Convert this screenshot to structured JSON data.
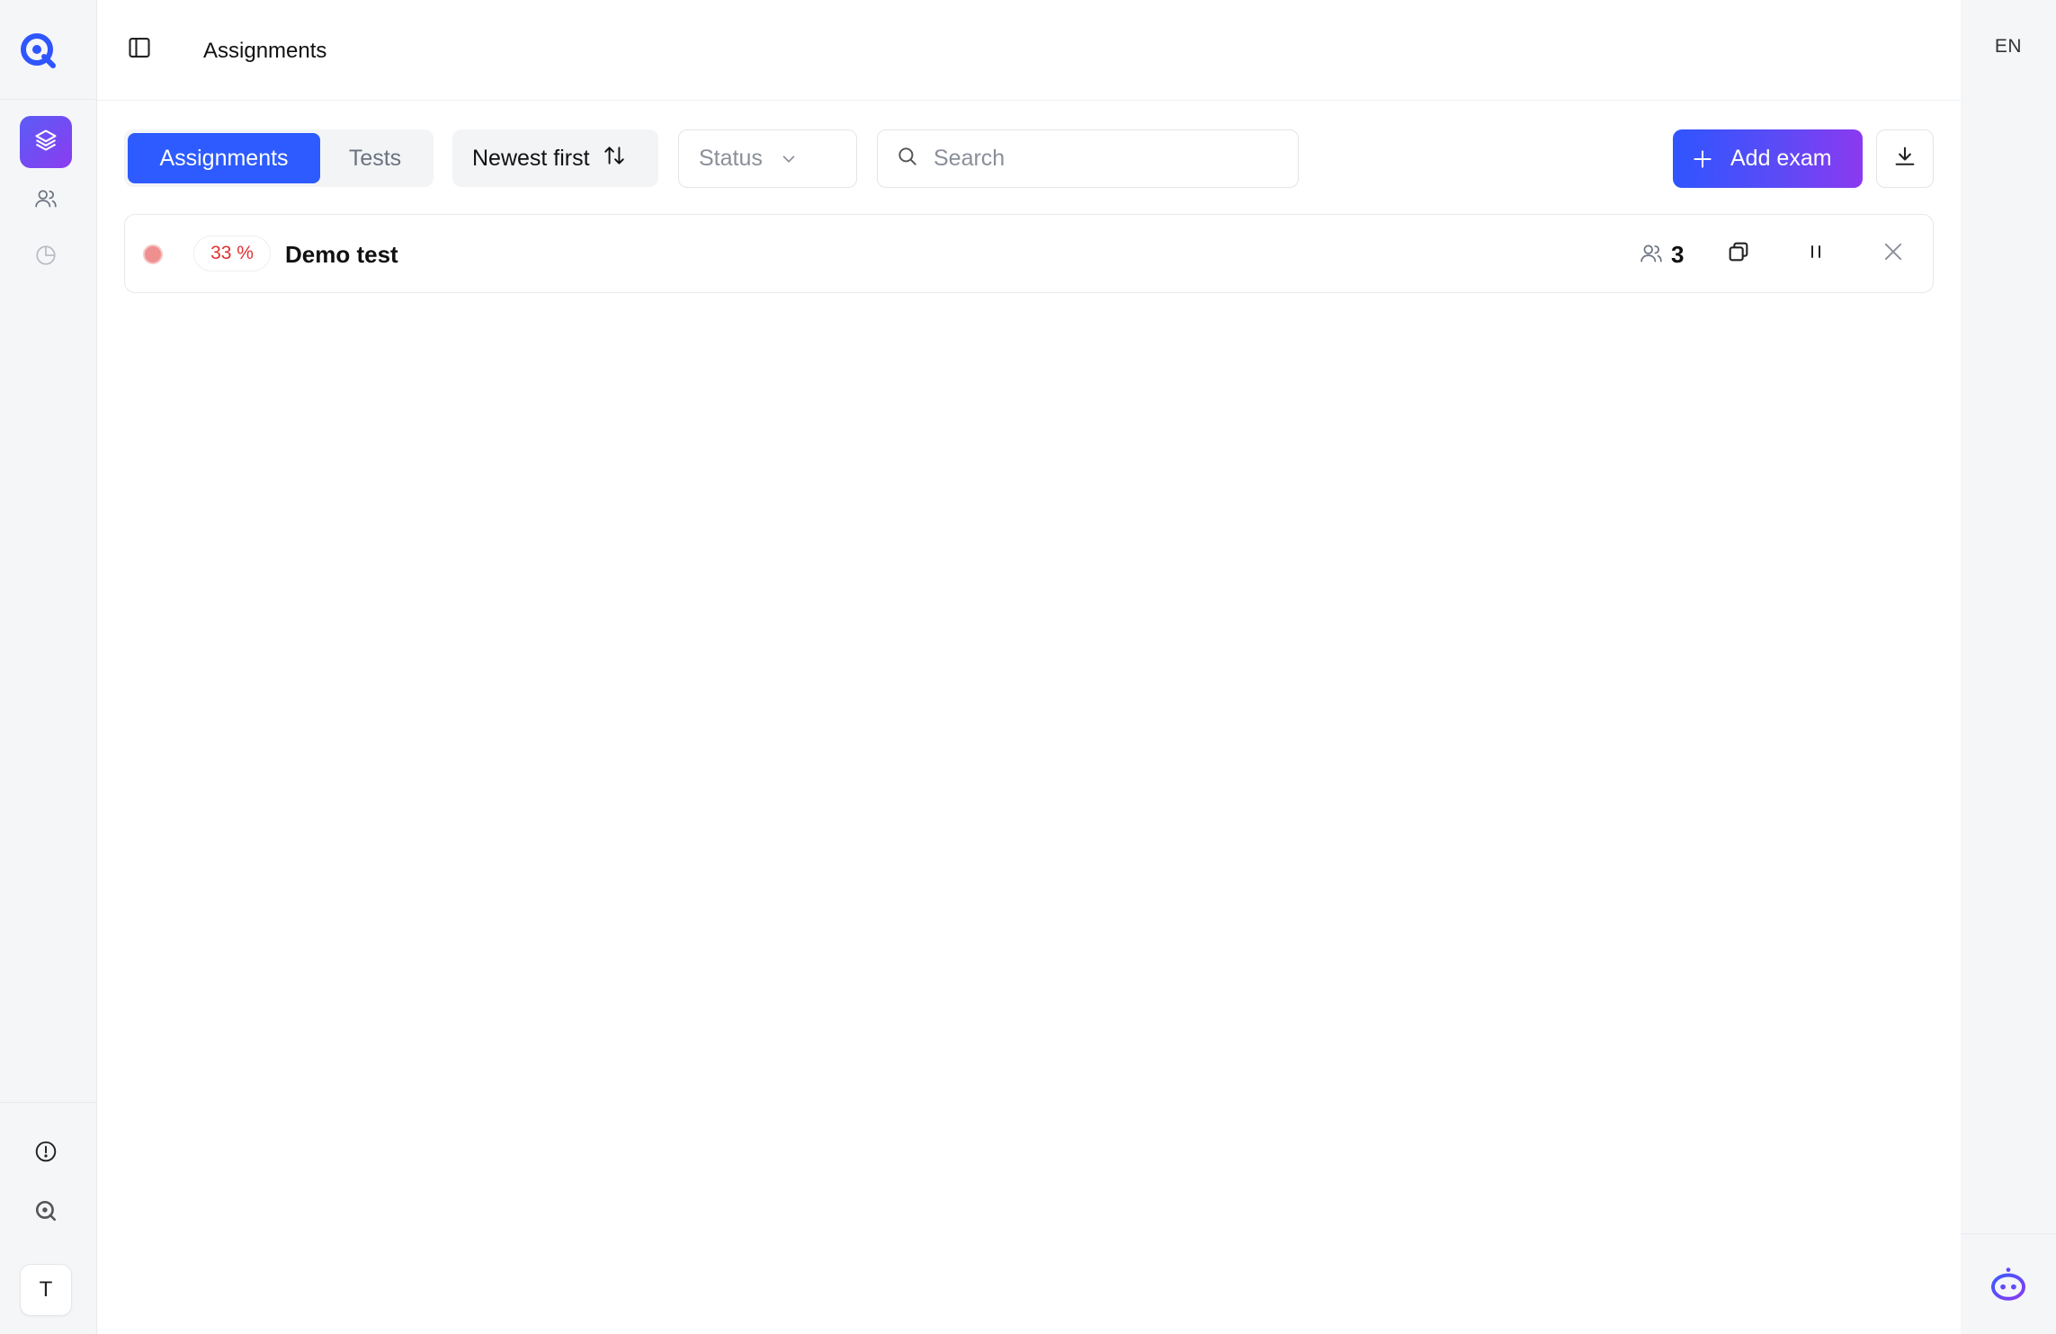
{
  "header": {
    "title": "Assignments",
    "language": "EN"
  },
  "rail": {
    "avatar_initial": "T"
  },
  "toolbar": {
    "tabs": [
      {
        "label": "Assignments",
        "active": true
      },
      {
        "label": "Tests",
        "active": false
      }
    ],
    "sort_label": "Newest first",
    "status_placeholder": "Status",
    "search_placeholder": "Search",
    "add_label": "Add exam"
  },
  "assignments": [
    {
      "status_color": "#ef8f8f",
      "percent": "33 %",
      "title": "Demo test",
      "participants": "3"
    }
  ],
  "colors": {
    "accent": "#2d5bff",
    "accent_gradient_end": "#8b39ef",
    "danger": "#e03131"
  }
}
